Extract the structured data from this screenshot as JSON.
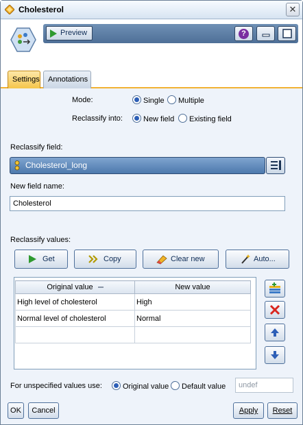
{
  "window": {
    "title": "Cholesterol",
    "close_label": "✕"
  },
  "toolbar": {
    "preview_label": "Preview",
    "help_label": "?"
  },
  "tabs": [
    {
      "label": "Settings",
      "active": true
    },
    {
      "label": "Annotations",
      "active": false
    }
  ],
  "settings": {
    "mode_label": "Mode:",
    "mode_options": [
      "Single",
      "Multiple"
    ],
    "mode_selected": "Single",
    "reclassify_into_label": "Reclassify into:",
    "reclassify_into_options": [
      "New field",
      "Existing field"
    ],
    "reclassify_into_selected": "New field",
    "reclassify_field_label": "Reclassify field:",
    "reclassify_field_value": "Cholesterol_long",
    "new_field_name_label": "New field name:",
    "new_field_name_value": "Cholesterol",
    "reclassify_values_label": "Reclassify values:"
  },
  "actions": {
    "get": "Get",
    "copy": "Copy",
    "clear_new": "Clear new",
    "auto": "Auto..."
  },
  "table": {
    "headers": [
      "Original value",
      "New value"
    ],
    "rows": [
      [
        "High level of cholesterol",
        "High"
      ],
      [
        "Normal level of cholesterol",
        "Normal"
      ],
      [
        "",
        ""
      ]
    ]
  },
  "unspecified": {
    "label": "For unspecified values use:",
    "options": [
      "Original value",
      "Default value"
    ],
    "selected": "Original value",
    "default_value": "undef"
  },
  "buttons": {
    "ok": "OK",
    "cancel": "Cancel",
    "apply": "Apply",
    "reset": "Reset"
  },
  "colors": {
    "accent_tab": "#f5c64b",
    "field_select": "#4d79ad",
    "delete_red": "#d9251d",
    "arrow_blue": "#2d5fb7"
  }
}
